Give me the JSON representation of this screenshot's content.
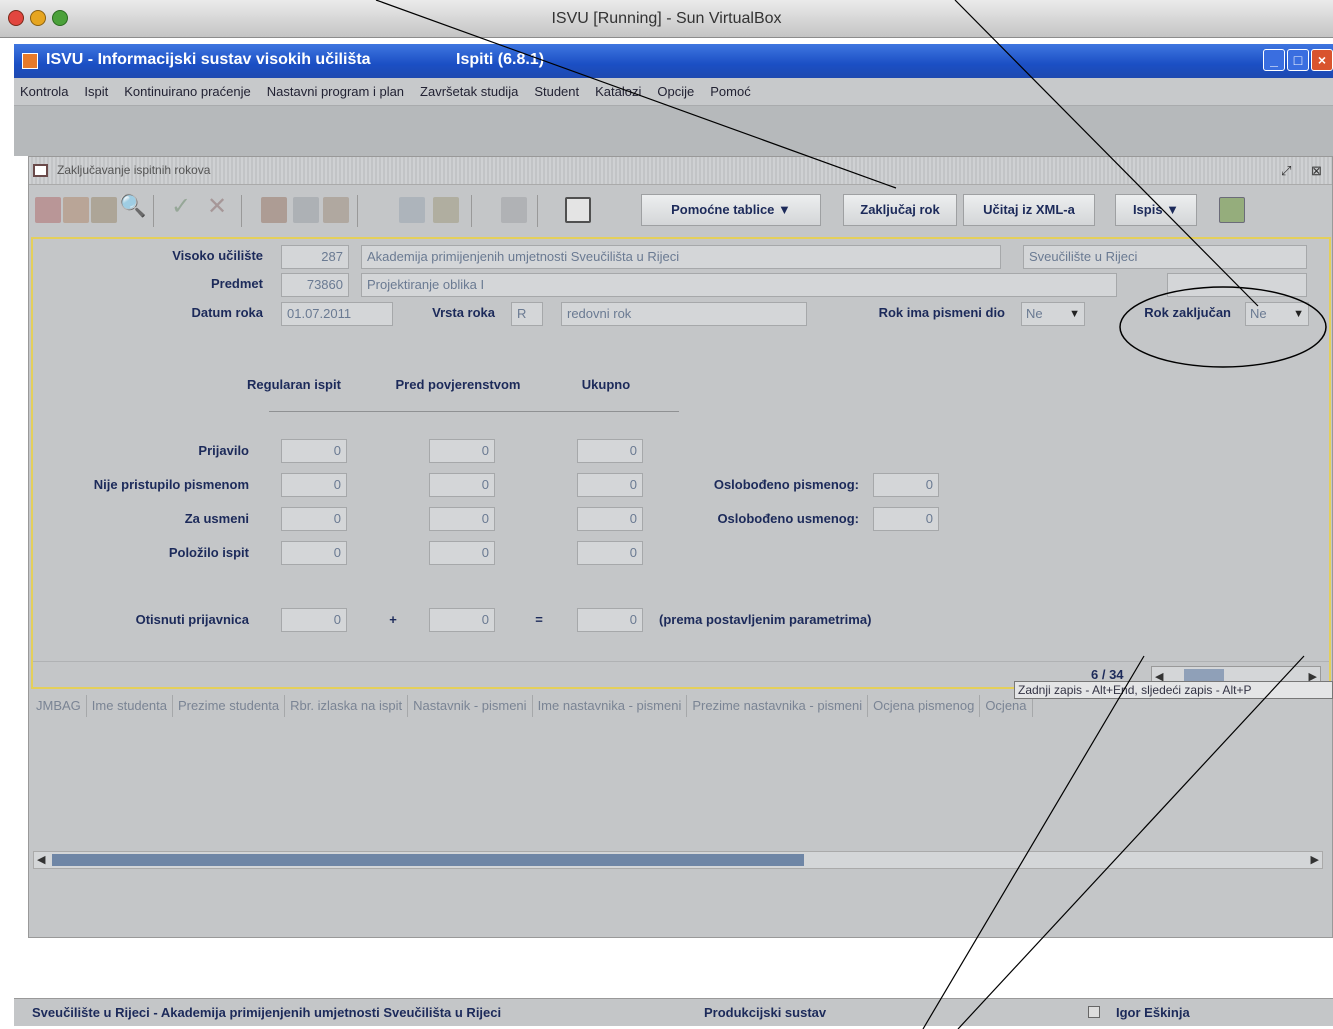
{
  "host": {
    "title": "ISVU [Running] - Sun VirtualBox"
  },
  "app": {
    "title": "ISVU - Informacijski sustav visokih učilišta",
    "subtitle": "Ispiti (6.8.1)",
    "menu": [
      "Kontrola",
      "Ispit",
      "Kontinuirano praćenje",
      "Nastavni program i plan",
      "Završetak studija",
      "Student",
      "Katalozi",
      "Opcije",
      "Pomoć"
    ]
  },
  "frame": {
    "title": "Zaključavanje ispitnih rokova",
    "toolbar": {
      "pomocne_tablice": "Pomoćne tablice ▼",
      "zakljucaj_rok": "Zaključaj rok",
      "ucitaj_xml": "Učitaj iz XML-a",
      "ispis": "Ispis ▼"
    }
  },
  "form": {
    "visoko_uciliste_label": "Visoko učilište",
    "visoko_uciliste_code": "287",
    "visoko_uciliste_name": "Akademija primijenjenih umjetnosti Sveučilišta u Rijeci",
    "sveuciliste": "Sveučilište u Rijeci",
    "predmet_label": "Predmet",
    "predmet_code": "73860",
    "predmet_name": "Projektiranje oblika I",
    "datum_roka_label": "Datum roka",
    "datum_roka": "01.07.2011",
    "vrsta_roka_label": "Vrsta roka",
    "vrsta_roka_code": "R",
    "vrsta_roka_name": "redovni rok",
    "rok_pismeni_label": "Rok ima pismeni dio",
    "rok_pismeni_value": "Ne",
    "rok_zakljucan_label": "Rok zaključan",
    "rok_zakljucan_value": "Ne",
    "col_regularan": "Regularan ispit",
    "col_pred_povjerenstvom": "Pred povjerenstvom",
    "col_ukupno": "Ukupno",
    "rows": [
      {
        "label": "Prijavilo",
        "regularan": "0",
        "povjerenstvo": "0",
        "ukupno": "0"
      },
      {
        "label": "Nije pristupilo pismenom",
        "regularan": "0",
        "povjerenstvo": "0",
        "ukupno": "0"
      },
      {
        "label": "Za usmeni",
        "regularan": "0",
        "povjerenstvo": "0",
        "ukupno": "0"
      },
      {
        "label": "Položilo ispit",
        "regularan": "0",
        "povjerenstvo": "0",
        "ukupno": "0"
      }
    ],
    "oslobodeno_pismenog_label": "Oslobođeno pismenog:",
    "oslobodeno_pismenog": "0",
    "oslobodeno_usmenog_label": "Oslobođeno usmenog:",
    "oslobodeno_usmenog": "0",
    "otisnuti_label": "Otisnuti prijavnica",
    "otisnuti_a": "0",
    "plus": "+",
    "otisnuti_b": "0",
    "equals": "=",
    "otisnuti_total": "0",
    "otisnuti_note": "(prema postavljenim parametrima)",
    "record_position": "6 / 34"
  },
  "table": {
    "headers": [
      "JMBAG",
      "Ime studenta",
      "Prezime studenta",
      "Rbr. izlaska na ispit",
      "Nastavnik - pismeni",
      "Ime nastavnika - pismeni",
      "Prezime nastavnika - pismeni",
      "Ocjena pismenog",
      "Ocjena"
    ]
  },
  "tooltip": "Zadnji zapis - Alt+End, sljedeći zapis - Alt+P",
  "status": {
    "left": "Sveučilište u Rijeci - Akademija primijenjenih umjetnosti Sveučilišta u Rijeci",
    "mid": "Produkcijski sustav",
    "user": "Igor Eškinja"
  }
}
